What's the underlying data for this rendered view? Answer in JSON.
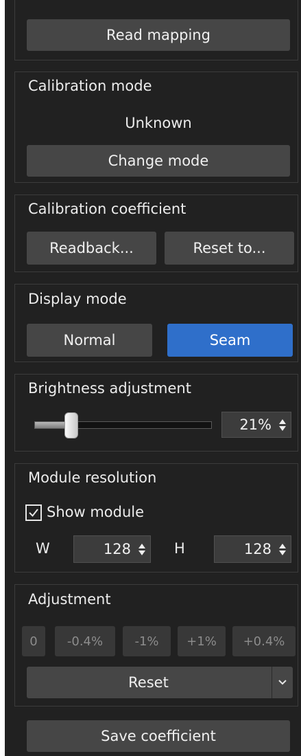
{
  "read_mapping": {
    "label": "Read mapping"
  },
  "calibration_mode": {
    "title": "Calibration mode",
    "status": "Unknown",
    "change_label": "Change mode"
  },
  "calibration_coefficient": {
    "title": "Calibration coefficient",
    "readback_label": "Readback...",
    "reset_label": "Reset to..."
  },
  "display_mode": {
    "title": "Display mode",
    "normal_label": "Normal",
    "seam_label": "Seam",
    "selected": "Seam"
  },
  "brightness": {
    "title": "Brightness adjustment",
    "value": 21,
    "value_label": "21%"
  },
  "module_resolution": {
    "title": "Module resolution",
    "show_module_label": "Show module",
    "show_module_checked": true,
    "w_label": "W",
    "w_value": "128",
    "h_label": "H",
    "h_value": "128"
  },
  "adjustment": {
    "title": "Adjustment",
    "steps": [
      "0",
      "-0.4%",
      "-1%",
      "+1%",
      "+0.4%"
    ],
    "reset_label": "Reset"
  },
  "save": {
    "label": "Save coefficient"
  },
  "colors": {
    "panel": "#212121",
    "button": "#464646",
    "accent": "#2f6fca",
    "border": "#3c3c3c"
  }
}
